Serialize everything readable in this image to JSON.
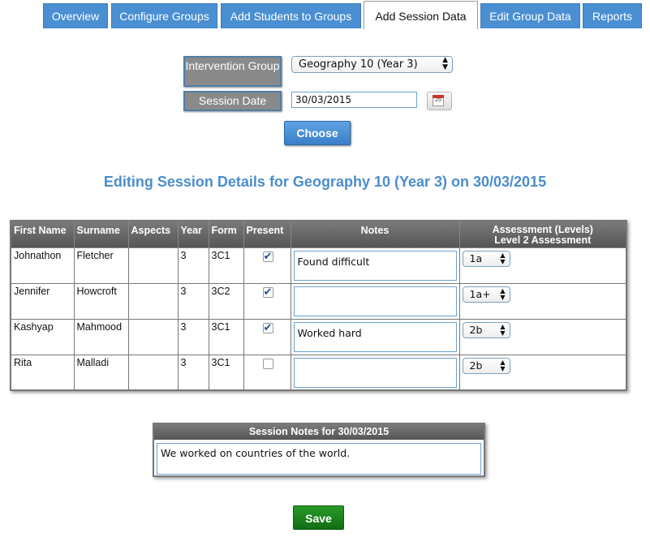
{
  "tabs": [
    "Overview",
    "Configure Groups",
    "Add Students to Groups",
    "Add Session Data",
    "Edit Group Data",
    "Reports"
  ],
  "active_tab": "Add Session Data",
  "form": {
    "group_label": "Intervention Group",
    "group_value": "Geography 10 (Year 3)",
    "date_label": "Session Date",
    "date_value": "30/03/2015",
    "calendar_day": "25",
    "choose_label": "Choose"
  },
  "heading": "Editing Session Details for Geography 10 (Year 3) on 30/03/2015",
  "table": {
    "headers": {
      "first_name": "First Name",
      "surname": "Surname",
      "aspects": "Aspects",
      "year": "Year",
      "form": "Form",
      "present": "Present",
      "notes": "Notes",
      "assessment_line1": "Assessment (Levels)",
      "assessment_line2": "Level 2 Assessment"
    },
    "rows": [
      {
        "first_name": "Johnathon",
        "surname": "Fletcher",
        "aspects": "",
        "year": "3",
        "form": "3C1",
        "present": true,
        "notes": "Found difficult",
        "level": "1a"
      },
      {
        "first_name": "Jennifer",
        "surname": "Howcroft",
        "aspects": "",
        "year": "3",
        "form": "3C2",
        "present": true,
        "notes": "",
        "level": "1a+"
      },
      {
        "first_name": "Kashyap",
        "surname": "Mahmood",
        "aspects": "",
        "year": "3",
        "form": "3C1",
        "present": true,
        "notes": "Worked hard",
        "level": "2b"
      },
      {
        "first_name": "Rita",
        "surname": "Malladi",
        "aspects": "",
        "year": "3",
        "form": "3C1",
        "present": false,
        "notes": "",
        "level": "2b"
      }
    ]
  },
  "session_notes": {
    "title": "Session Notes for 30/03/2015",
    "text": "We worked on countries of the world."
  },
  "save_label": "Save",
  "colors": {
    "tab_blue": "#4a8fd2",
    "heading_blue": "#4b8dcc",
    "save_green": "#1a861a",
    "header_gray": "#666666"
  }
}
